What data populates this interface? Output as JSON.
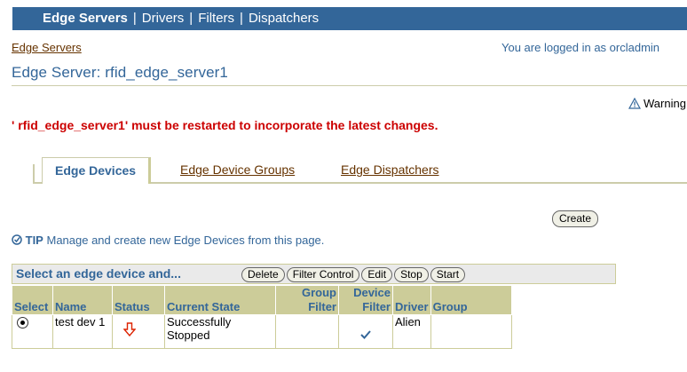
{
  "nav": {
    "items": [
      "Edge Servers",
      "Drivers",
      "Filters",
      "Dispatchers"
    ],
    "separator": "|"
  },
  "breadcrumb": "Edge Servers",
  "logged_in": "You are logged in as orcladmin",
  "page_title": "Edge Server: rfid_edge_server1",
  "warning_label": "Warning",
  "error_message": "' rfid_edge_server1' must be restarted to incorporate the latest changes.",
  "tabs": [
    "Edge Devices",
    "Edge Device Groups",
    "Edge Dispatchers"
  ],
  "create_button": "Create",
  "tip": {
    "label": "TIP",
    "text": "Manage and create new Edge Devices from this page."
  },
  "action_bar": {
    "label": "Select an edge device and...",
    "buttons": [
      "Delete",
      "Filter Control",
      "Edit",
      "Stop",
      "Start"
    ]
  },
  "table": {
    "headers": [
      "Select",
      "Name",
      "Status",
      "Current State",
      "Group Filter",
      "Device Filter",
      "Driver",
      "Group"
    ],
    "header_lines": {
      "group_filter": [
        "Group",
        "Filter"
      ],
      "device_filter": [
        "Device",
        "Filter"
      ]
    },
    "rows": [
      {
        "selected": true,
        "name": "test dev 1",
        "status_icon": "down-arrow-icon",
        "current_state": "Successfully Stopped",
        "group_filter": "",
        "device_filter_icon": "checkmark-icon",
        "driver": "Alien",
        "group": ""
      }
    ]
  },
  "colors": {
    "nav_bg": "#336699",
    "header_bg": "#cccc99",
    "error": "#cc0000",
    "link": "#663300",
    "title": "#336699"
  }
}
